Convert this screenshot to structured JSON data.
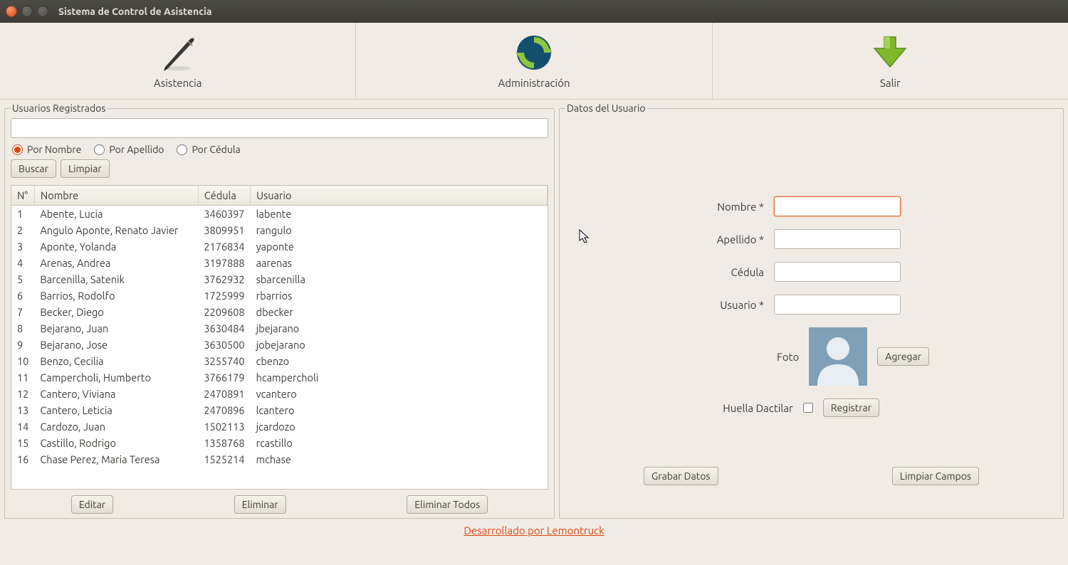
{
  "window": {
    "title": "Sistema de Control de Asistencia"
  },
  "toolbar": {
    "asistencia": "Asistencia",
    "administracion": "Administración",
    "salir": "Salir"
  },
  "left": {
    "legend": "Usuarios Registrados",
    "search_value": "",
    "filters": {
      "nombre": "Por Nombre",
      "apellido": "Por Apellido",
      "cedula": "Por Cédula"
    },
    "buscar": "Buscar",
    "limpiar": "Limpiar",
    "cols": {
      "n": "N°",
      "nombre": "Nombre",
      "cedula": "Cédula",
      "usuario": "Usuario"
    },
    "rows": [
      {
        "n": "1",
        "nombre": "Abente, Lucia",
        "cedula": "3460397",
        "usuario": "labente"
      },
      {
        "n": "2",
        "nombre": "Angulo Aponte, Renato Javier",
        "cedula": "3809951",
        "usuario": "rangulo"
      },
      {
        "n": "3",
        "nombre": "Aponte, Yolanda",
        "cedula": "2176834",
        "usuario": "yaponte"
      },
      {
        "n": "4",
        "nombre": "Arenas, Andrea",
        "cedula": "3197888",
        "usuario": "aarenas"
      },
      {
        "n": "5",
        "nombre": "Barcenilla, Satenik",
        "cedula": "3762932",
        "usuario": "sbarcenilla"
      },
      {
        "n": "6",
        "nombre": "Barrios, Rodolfo",
        "cedula": "1725999",
        "usuario": "rbarrios"
      },
      {
        "n": "7",
        "nombre": "Becker, Diego",
        "cedula": "2209608",
        "usuario": "dbecker"
      },
      {
        "n": "8",
        "nombre": "Bejarano, Juan",
        "cedula": "3630484",
        "usuario": "jbejarano"
      },
      {
        "n": "9",
        "nombre": "Bejarano, Jose",
        "cedula": "3630500",
        "usuario": "jobejarano"
      },
      {
        "n": "10",
        "nombre": "Benzo, Cecilia",
        "cedula": "3255740",
        "usuario": "cbenzo"
      },
      {
        "n": "11",
        "nombre": "Campercholi, Humberto",
        "cedula": "3766179",
        "usuario": "hcampercholi"
      },
      {
        "n": "12",
        "nombre": "Cantero, Viviana",
        "cedula": "2470891",
        "usuario": "vcantero"
      },
      {
        "n": "13",
        "nombre": "Cantero, Leticia",
        "cedula": "2470896",
        "usuario": "lcantero"
      },
      {
        "n": "14",
        "nombre": "Cardozo, Juan",
        "cedula": "1502113",
        "usuario": "jcardozo"
      },
      {
        "n": "15",
        "nombre": "Castillo, Rodrigo",
        "cedula": "1358768",
        "usuario": "rcastillo"
      },
      {
        "n": "16",
        "nombre": "Chase Perez, Maria Teresa",
        "cedula": "1525214",
        "usuario": "mchase"
      }
    ],
    "editar": "Editar",
    "eliminar": "Eliminar",
    "eliminar_todos": "Eliminar Todos"
  },
  "right": {
    "legend": "Datos del Usuario",
    "labels": {
      "nombre": "Nombre *",
      "apellido": "Apellido *",
      "cedula": "Cédula",
      "usuario": "Usuario *",
      "foto": "Foto",
      "huella": "Huella Dactilar"
    },
    "agregar": "Agregar",
    "registrar": "Registrar",
    "grabar": "Grabar Datos",
    "limpiar_campos": "Limpiar Campos"
  },
  "footer": {
    "link": "Desarrollado por Lemontruck"
  }
}
